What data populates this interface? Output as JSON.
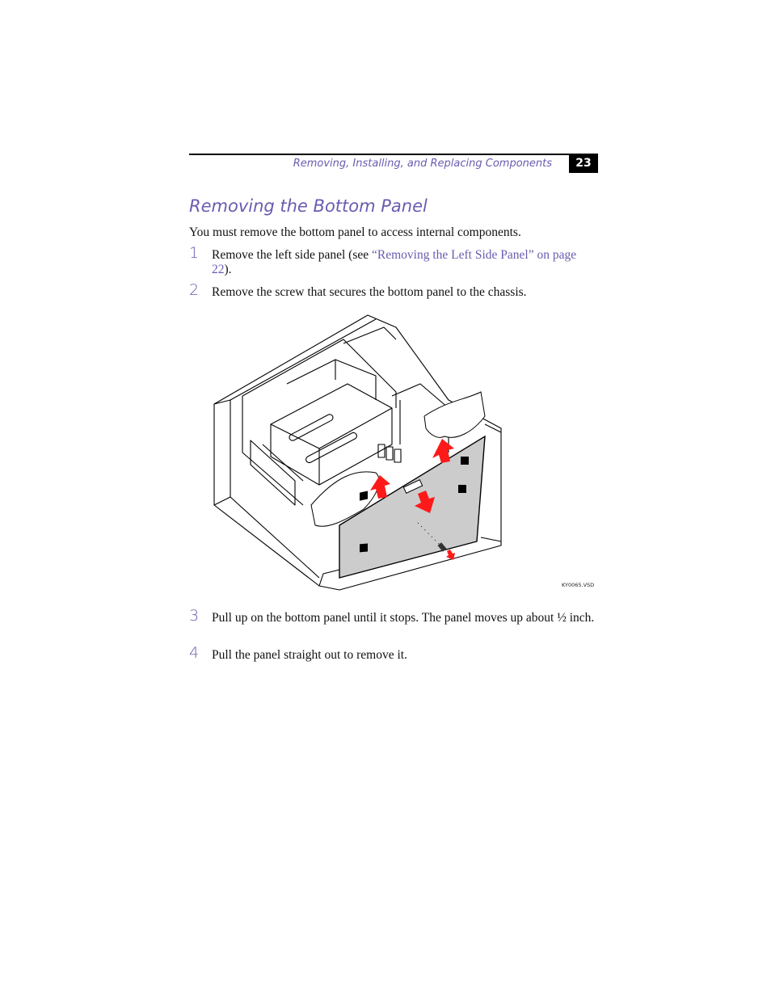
{
  "header": {
    "running_title": "Removing, Installing, and Replacing Components",
    "page_number": "23"
  },
  "section": {
    "title": "Removing the Bottom Panel",
    "intro": "You must remove the bottom panel to access internal components."
  },
  "steps": [
    {
      "number": "1",
      "text_before": "Remove the left side panel (see ",
      "link_text": "“Removing the Left Side Panel” on page 22",
      "text_after": ")."
    },
    {
      "number": "2",
      "text": "Remove the screw that secures the bottom panel to the chassis."
    },
    {
      "number": "3",
      "text": "Pull up on the bottom panel until it stops. The panel moves up about ½ inch."
    },
    {
      "number": "4",
      "text": "Pull the panel straight out to remove it."
    }
  ],
  "figure": {
    "label": "KY0065.VSD",
    "description": "Computer chassis with hands pulling up the bottom panel; red arrows indicate motion; screw removed",
    "colors": {
      "arrow": "#ff1a1a",
      "panel": "#cccccc",
      "line": "#000000"
    }
  },
  "colors": {
    "accent": "#6b5bb0",
    "text": "#111111"
  }
}
